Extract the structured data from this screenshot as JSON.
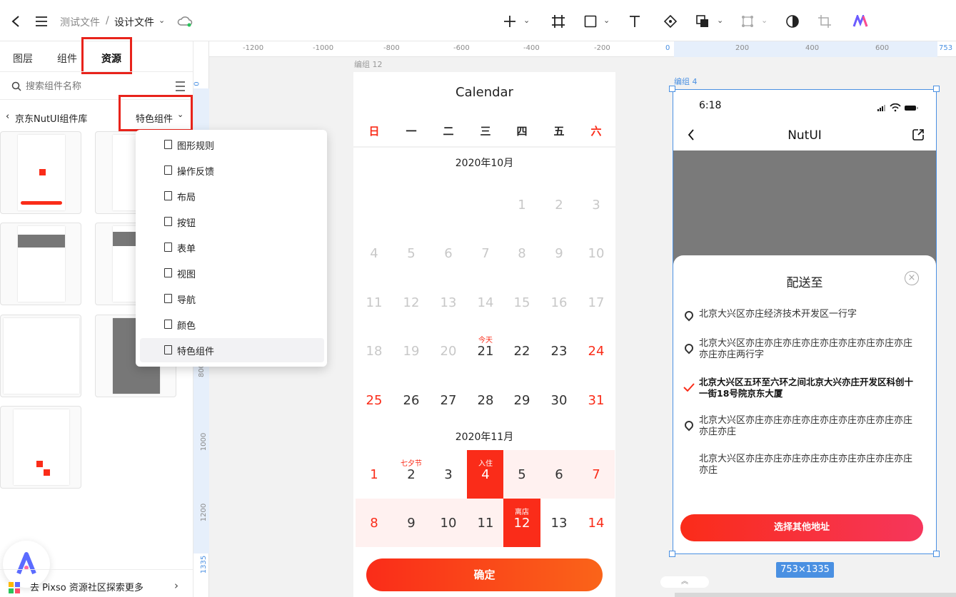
{
  "header": {
    "breadcrumb_root": "测试文件",
    "breadcrumb_sep": "/",
    "breadcrumb_current": "设计文件"
  },
  "left_panel": {
    "tabs": [
      "图层",
      "组件",
      "资源"
    ],
    "search_placeholder": "搜索组件名称",
    "library_name": "京东NutUI组件库",
    "category_select": "特色组件",
    "footer_text": "去 Pixso 资源社区探索更多"
  },
  "dropdown": {
    "items": [
      "图形规则",
      "操作反馈",
      "布局",
      "按钮",
      "表单",
      "视图",
      "导航",
      "颜色",
      "特色组件"
    ],
    "selected": "特色组件"
  },
  "rulers": {
    "h_ticks": [
      "-1200",
      "-1000",
      "-800",
      "-600",
      "-400",
      "-200",
      "0",
      "200",
      "400",
      "600",
      "753"
    ],
    "v_ticks": [
      "0",
      "800",
      "1000",
      "1200",
      "1335"
    ]
  },
  "calendar_frame": {
    "frame_label": "编组 12",
    "title": "Calendar",
    "weekdays": [
      "日",
      "一",
      "二",
      "三",
      "四",
      "五",
      "六"
    ],
    "month1": "2020年10月",
    "month2": "2020年11月",
    "today_tag": "今天",
    "holiday_tag": "七夕节",
    "checkin_tag": "入住",
    "checkout_tag": "离店",
    "confirm_button": "确定",
    "oct_days": [
      "1",
      "2",
      "3",
      "4",
      "5",
      "6",
      "7",
      "8",
      "9",
      "10",
      "11",
      "12",
      "13",
      "14",
      "15",
      "16",
      "17",
      "18",
      "19",
      "20",
      "21",
      "22",
      "23",
      "24",
      "25",
      "26",
      "27",
      "28",
      "29",
      "30",
      "31"
    ],
    "nov_days": [
      "1",
      "2",
      "3",
      "4",
      "5",
      "6",
      "7",
      "8",
      "9",
      "10",
      "11",
      "12",
      "13",
      "14"
    ]
  },
  "phone_frame": {
    "frame_label": "编组 4",
    "time": "6:18",
    "nav_title": "NutUI",
    "popup_title": "配送至",
    "addresses": [
      "北京大兴区亦庄经济技术开发区一行字",
      "北京大兴区亦庄亦庄亦庄亦庄亦庄亦庄亦庄亦庄亦庄亦庄亦庄两行字",
      "北京大兴区五环至六环之间北京大兴亦庄开发区科创十一街18号院京东大厦",
      "北京大兴区亦庄亦庄亦庄亦庄亦庄亦庄亦庄亦庄亦庄亦庄亦庄",
      "北京大兴区亦庄亦庄亦庄亦庄亦庄亦庄亦庄亦庄亦庄亦庄"
    ],
    "other_address_button": "选择其他地址",
    "size_badge": "753×1335"
  },
  "colors": {
    "accent_red": "#fa2c19",
    "selection_blue": "#4a90e2",
    "annotation_red": "#e8231b"
  }
}
